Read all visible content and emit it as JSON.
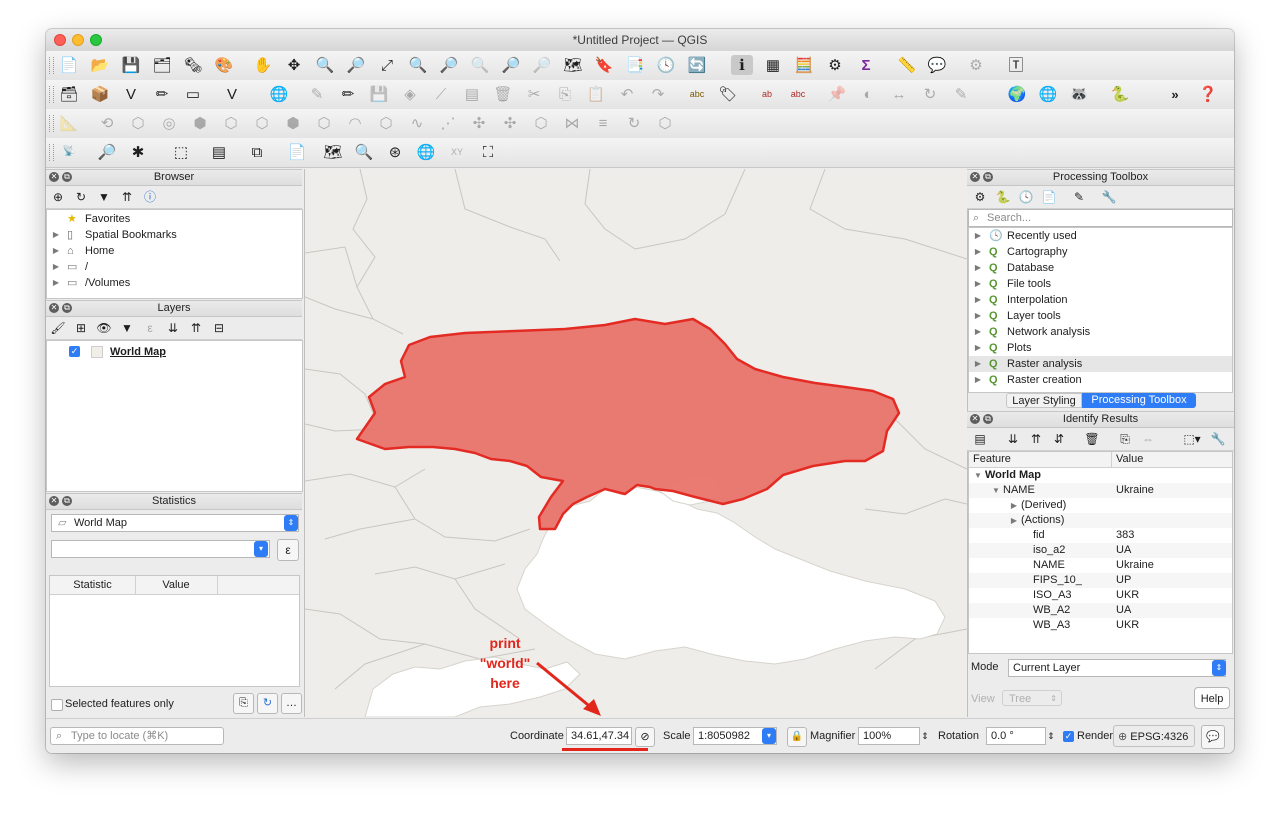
{
  "window": {
    "title": "*Untitled Project — QGIS"
  },
  "panels": {
    "browser": {
      "title": "Browser",
      "items": [
        {
          "label": "Favorites",
          "icon": "star-icon"
        },
        {
          "label": "Spatial Bookmarks",
          "icon": "bookmark-icon"
        },
        {
          "label": "Home",
          "icon": "home-icon"
        },
        {
          "label": "/",
          "icon": "folder-icon"
        },
        {
          "label": "/Volumes",
          "icon": "folder-icon"
        }
      ]
    },
    "layers": {
      "title": "Layers",
      "items": [
        {
          "label": "World Map",
          "checked": true
        }
      ]
    },
    "statistics": {
      "title": "Statistics",
      "layer_select": "World Map",
      "expression_button": "ε",
      "headers": [
        "Statistic",
        "Value"
      ],
      "selected_only_label": "Selected features only"
    },
    "processing": {
      "title": "Processing Toolbox",
      "search_placeholder": "Search...",
      "items": [
        {
          "label": "Recently used",
          "icon": "clock-icon"
        },
        {
          "label": "Cartography",
          "icon": "qgis-logo-icon"
        },
        {
          "label": "Database",
          "icon": "qgis-logo-icon"
        },
        {
          "label": "File tools",
          "icon": "qgis-logo-icon"
        },
        {
          "label": "Interpolation",
          "icon": "qgis-logo-icon"
        },
        {
          "label": "Layer tools",
          "icon": "qgis-logo-icon"
        },
        {
          "label": "Network analysis",
          "icon": "qgis-logo-icon"
        },
        {
          "label": "Plots",
          "icon": "qgis-logo-icon"
        },
        {
          "label": "Raster analysis",
          "icon": "qgis-logo-icon"
        },
        {
          "label": "Raster creation",
          "icon": "qgis-logo-icon"
        }
      ],
      "tabs": [
        "Layer Styling",
        "Processing Toolbox"
      ]
    },
    "identify": {
      "title": "Identify Results",
      "headers": [
        "Feature",
        "Value"
      ],
      "rows": [
        {
          "label": "World Map",
          "value": "",
          "level": 0,
          "bold": true,
          "expand": "▼"
        },
        {
          "label": "NAME",
          "value": "Ukraine",
          "level": 1,
          "bold": false,
          "expand": "▼"
        },
        {
          "label": "(Derived)",
          "value": "",
          "level": 2,
          "bold": false,
          "expand": "▶"
        },
        {
          "label": "(Actions)",
          "value": "",
          "level": 2,
          "bold": false,
          "expand": "▶"
        },
        {
          "label": "fid",
          "value": "383",
          "level": 3,
          "bold": false,
          "expand": ""
        },
        {
          "label": "iso_a2",
          "value": "UA",
          "level": 3,
          "bold": false,
          "expand": ""
        },
        {
          "label": "NAME",
          "value": "Ukraine",
          "level": 3,
          "bold": false,
          "expand": ""
        },
        {
          "label": "FIPS_10_",
          "value": "UP",
          "level": 3,
          "bold": false,
          "expand": ""
        },
        {
          "label": "ISO_A3",
          "value": "UKR",
          "level": 3,
          "bold": false,
          "expand": ""
        },
        {
          "label": "WB_A2",
          "value": "UA",
          "level": 3,
          "bold": false,
          "expand": ""
        },
        {
          "label": "WB_A3",
          "value": "UKR",
          "level": 3,
          "bold": false,
          "expand": ""
        }
      ],
      "mode_label": "Mode",
      "mode_value": "Current Layer",
      "view_label": "View",
      "view_value": "Tree",
      "help_label": "Help"
    }
  },
  "statusbar": {
    "locate_placeholder": "Type to locate (⌘K)",
    "coordinate_label": "Coordinate",
    "coordinate_value": "34.61,47.34",
    "scale_label": "Scale",
    "scale_value": "1:8050982",
    "magnifier_label": "Magnifier",
    "magnifier_value": "100%",
    "rotation_label": "Rotation",
    "rotation_value": "0.0 °",
    "render_label": "Render",
    "crs_value": "EPSG:4326"
  },
  "annotation": {
    "line1": "print",
    "line2": "\"world\"",
    "line3": "here"
  },
  "colors": {
    "highlight_fill": "#e8746b",
    "highlight_stroke": "#e32b24",
    "land": "#eeedea",
    "sea": "#ffffff",
    "accent": "#2f7df6"
  }
}
